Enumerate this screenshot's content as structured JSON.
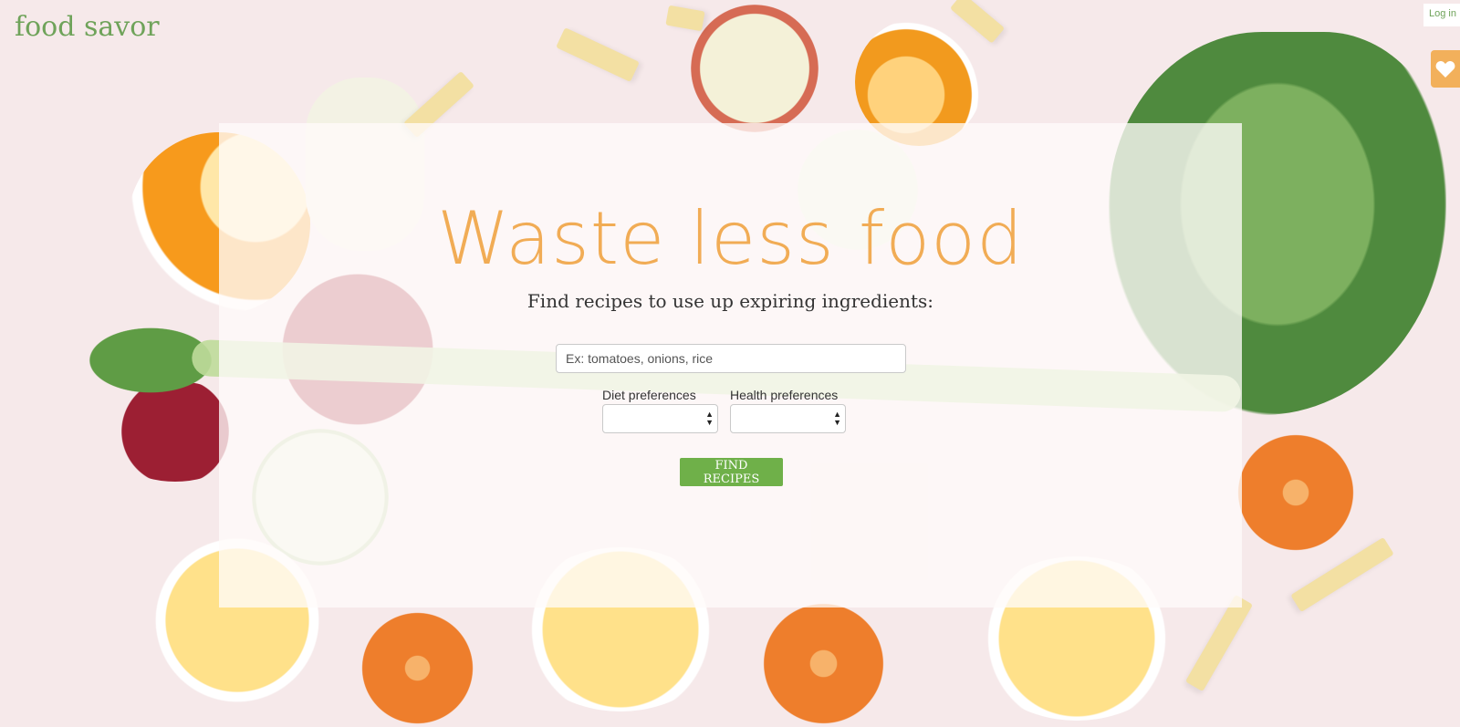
{
  "header": {
    "brand": "food savor",
    "login_label": "Log in"
  },
  "favorites": {
    "icon": "heart-icon",
    "color": "#f2b05b"
  },
  "hero": {
    "headline": "Waste less food",
    "subheadline": "Find recipes to use up expiring ingredients:"
  },
  "search": {
    "placeholder": "Ex: tomatoes, onions, rice",
    "value": ""
  },
  "filters": {
    "diet_label": "Diet preferences",
    "diet_value": "",
    "health_label": "Health preferences",
    "health_value": ""
  },
  "actions": {
    "find_label": "FIND RECIPES"
  },
  "colors": {
    "brand_green": "#6fa35a",
    "headline_orange": "#f1ac55",
    "button_green": "#6fb049"
  }
}
